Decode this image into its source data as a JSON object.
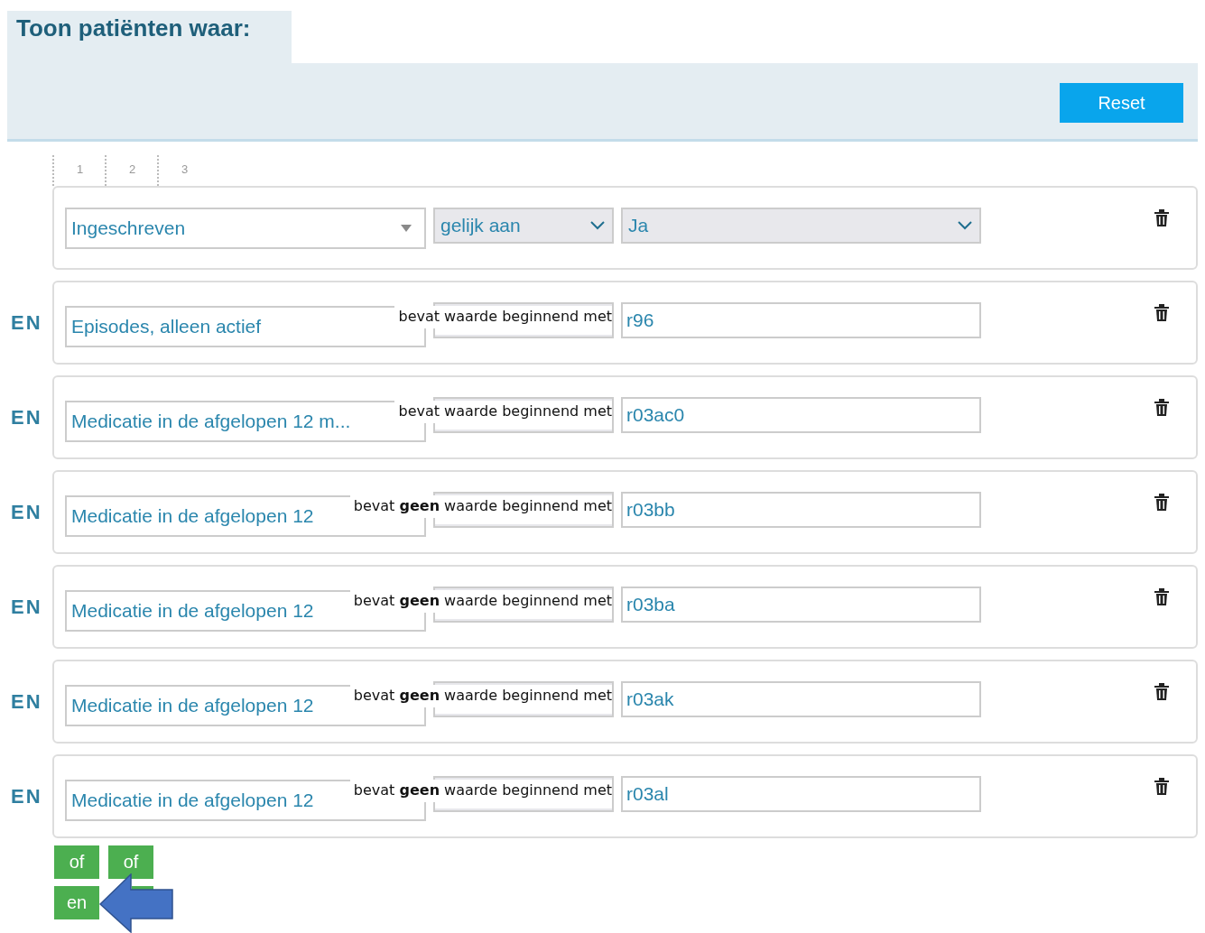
{
  "header": {
    "title": "Toon patiënten waar:",
    "reset_button": "Reset"
  },
  "columns": [
    "1",
    "2",
    "3"
  ],
  "conditions": [
    {
      "kind": "select",
      "field": "Ingeschreven",
      "operator": "gelijk aan",
      "value": "Ja"
    },
    {
      "kind": "text",
      "connector": "EN",
      "field": "Episodes, alleen actief",
      "operator": "bevat waarde beginnend met",
      "value": "r96"
    },
    {
      "kind": "text",
      "connector": "EN",
      "field": "Medicatie in de afgelopen 12 m...",
      "operator": "bevat waarde beginnend met",
      "value": "r03ac0"
    },
    {
      "kind": "text",
      "connector": "EN",
      "field": "Medicatie in de afgelopen 12",
      "operator": "bevat **geen** waarde beginnend met",
      "value": "r03bb"
    },
    {
      "kind": "text",
      "connector": "EN",
      "field": "Medicatie in de afgelopen 12",
      "operator": "bevat **geen** waarde beginnend met",
      "value": "r03ba"
    },
    {
      "kind": "text",
      "connector": "EN",
      "field": "Medicatie in de afgelopen 12",
      "operator": "bevat **geen** waarde beginnend met",
      "value": "r03ak"
    },
    {
      "kind": "text",
      "connector": "EN",
      "field": "Medicatie in de afgelopen 12",
      "operator": "bevat **geen** waarde beginnend met",
      "value": "r03al"
    }
  ],
  "logic_buttons": [
    {
      "kind": "label",
      "label": "of"
    },
    {
      "kind": "label",
      "label": "of"
    },
    {
      "kind": "label",
      "label": "en"
    },
    {
      "kind": "covered"
    }
  ]
}
